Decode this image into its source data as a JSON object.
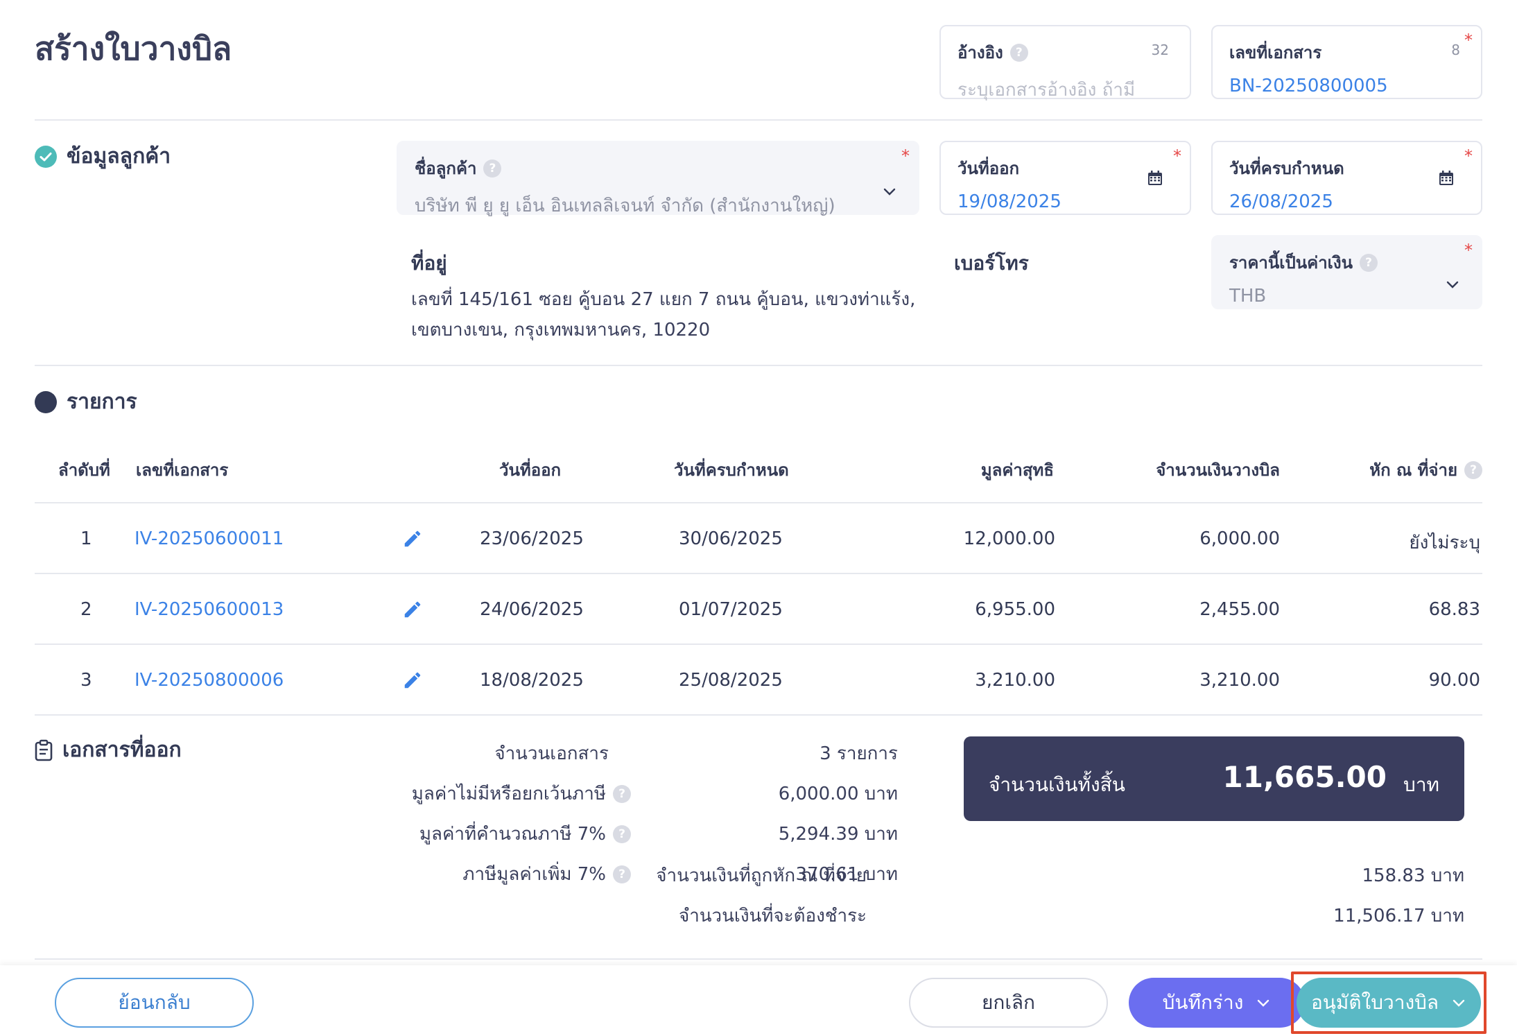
{
  "page": {
    "title": "สร้างใบวางบิล"
  },
  "reference": {
    "label": "อ้างอิง",
    "placeholder": "ระบุเอกสารอ้างอิง ถ้ามี",
    "counter": "32"
  },
  "doc_number": {
    "label": "เลขที่เอกสาร",
    "value": "BN-20250800005",
    "counter": "8",
    "required": "*"
  },
  "customer_section": {
    "title": "ข้อมูลลูกค้า",
    "customer_name": {
      "label": "ชื่อลูกค้า",
      "value": "บริษัท พี ยู ยู เอ็น อินเทลลิเจนท์ จำกัด (สำนักงานใหญ่)",
      "required": "*"
    },
    "issue_date": {
      "label": "วันที่ออก",
      "value": "19/08/2025",
      "required": "*"
    },
    "due_date": {
      "label": "วันที่ครบกำหนด",
      "value": "26/08/2025",
      "required": "*"
    },
    "address": {
      "label": "ที่อยู่",
      "line1": "เลขที่ 145/161 ซอย คู้บอน 27 แยก 7 ถนน คู้บอน, แขวงท่าแร้ง,",
      "line2": "เขตบางเขน, กรุงเทพมหานคร, 10220"
    },
    "phone": {
      "label": "เบอร์โทร"
    },
    "currency": {
      "label": "ราคานี้เป็นค่าเงิน",
      "value": "THB",
      "required": "*"
    }
  },
  "items_section": {
    "title": "รายการ",
    "columns": {
      "index": "ลำดับที่",
      "doc_no": "เลขที่เอกสาร",
      "issue_date": "วันที่ออก",
      "due_date": "วันที่ครบกำหนด",
      "net_value": "มูลค่าสุทธิ",
      "bill_amount": "จำนวนเงินวางบิล",
      "withholding": "หัก ณ ที่จ่าย"
    },
    "rows": [
      {
        "index": "1",
        "doc_no": "IV-20250600011",
        "issue_date": "23/06/2025",
        "due_date": "30/06/2025",
        "net_value": "12,000.00",
        "bill_amount": "6,000.00",
        "withholding": "ยังไม่ระบุ"
      },
      {
        "index": "2",
        "doc_no": "IV-20250600013",
        "issue_date": "24/06/2025",
        "due_date": "01/07/2025",
        "net_value": "6,955.00",
        "bill_amount": "2,455.00",
        "withholding": "68.83"
      },
      {
        "index": "3",
        "doc_no": "IV-20250800006",
        "issue_date": "18/08/2025",
        "due_date": "25/08/2025",
        "net_value": "3,210.00",
        "bill_amount": "3,210.00",
        "withholding": "90.00"
      }
    ]
  },
  "documents_section": {
    "title": "เอกสารที่ออก"
  },
  "summary": {
    "doc_count_label": "จำนวนเอกสาร",
    "doc_count_value": "3 รายการ",
    "non_vat_label": "มูลค่าไม่มีหรือยกเว้นภาษี",
    "non_vat_value": "6,000.00 บาท",
    "vat_base_label": "มูลค่าที่คำนวณภาษี 7%",
    "vat_base_value": "5,294.39 บาท",
    "vat_label": "ภาษีมูลค่าเพิ่ม 7%",
    "vat_value": "370.61 บาท",
    "total_label": "จำนวนเงินทั้งสิ้น",
    "total_value": "11,665.00",
    "total_unit": "บาท",
    "withheld_label": "จำนวนเงินที่ถูกหัก ณ ที่จ่าย",
    "withheld_value": "158.83 บาท",
    "payable_label": "จำนวนเงินที่จะต้องชำระ",
    "payable_value": "11,506.17 บาท"
  },
  "footer": {
    "back_label": "ย้อนกลับ",
    "cancel_label": "ยกเลิก",
    "save_draft_label": "บันทึกร่าง",
    "approve_label": "อนุมัติใบวางบิล"
  },
  "colors": {
    "link": "#3b82e6",
    "primary_dark": "#3a3d5e",
    "purple": "#6b6ef0",
    "teal": "#5ab9c5",
    "success": "#4dbbb8",
    "required": "#e54848",
    "highlight": "#e0482c"
  },
  "icons": {
    "help": "question-circle-icon",
    "calendar": "calendar-icon",
    "chevron": "chevron-down-icon",
    "edit": "pencil-icon",
    "check": "check-circle-icon",
    "clipboard": "clipboard-icon",
    "dot": "circle-dot-icon"
  }
}
